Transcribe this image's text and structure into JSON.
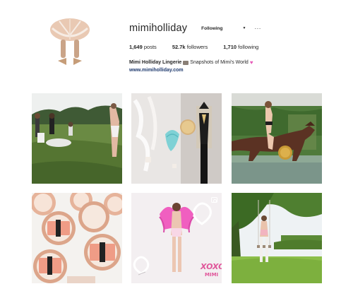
{
  "profile": {
    "username": "mimiholliday",
    "follow_label": "Following",
    "more_label": "···",
    "posts_count": "1,649",
    "posts_label": "posts",
    "followers_count": "52.7k",
    "followers_label": "followers",
    "following_count": "1,710",
    "following_label": "following",
    "bio_name": "Mimi Holliday Lingerie",
    "bio_text": "Snapshots of Mimi's World",
    "website": "www.mimiholliday.com"
  },
  "posts": [
    {
      "subject": "field-group-photo"
    },
    {
      "subject": "lingerie-boutique-display"
    },
    {
      "subject": "horse-rider-photo"
    },
    {
      "subject": "gift-boxes-on-plates"
    },
    {
      "subject": "pink-angel-wings-video",
      "overlay_text": "XOXO",
      "overlay_subtext": "MIMI"
    },
    {
      "subject": "garden-swing-photo"
    }
  ],
  "colors": {
    "link": "#1f3a6e",
    "accent_pink": "#e0579b"
  }
}
